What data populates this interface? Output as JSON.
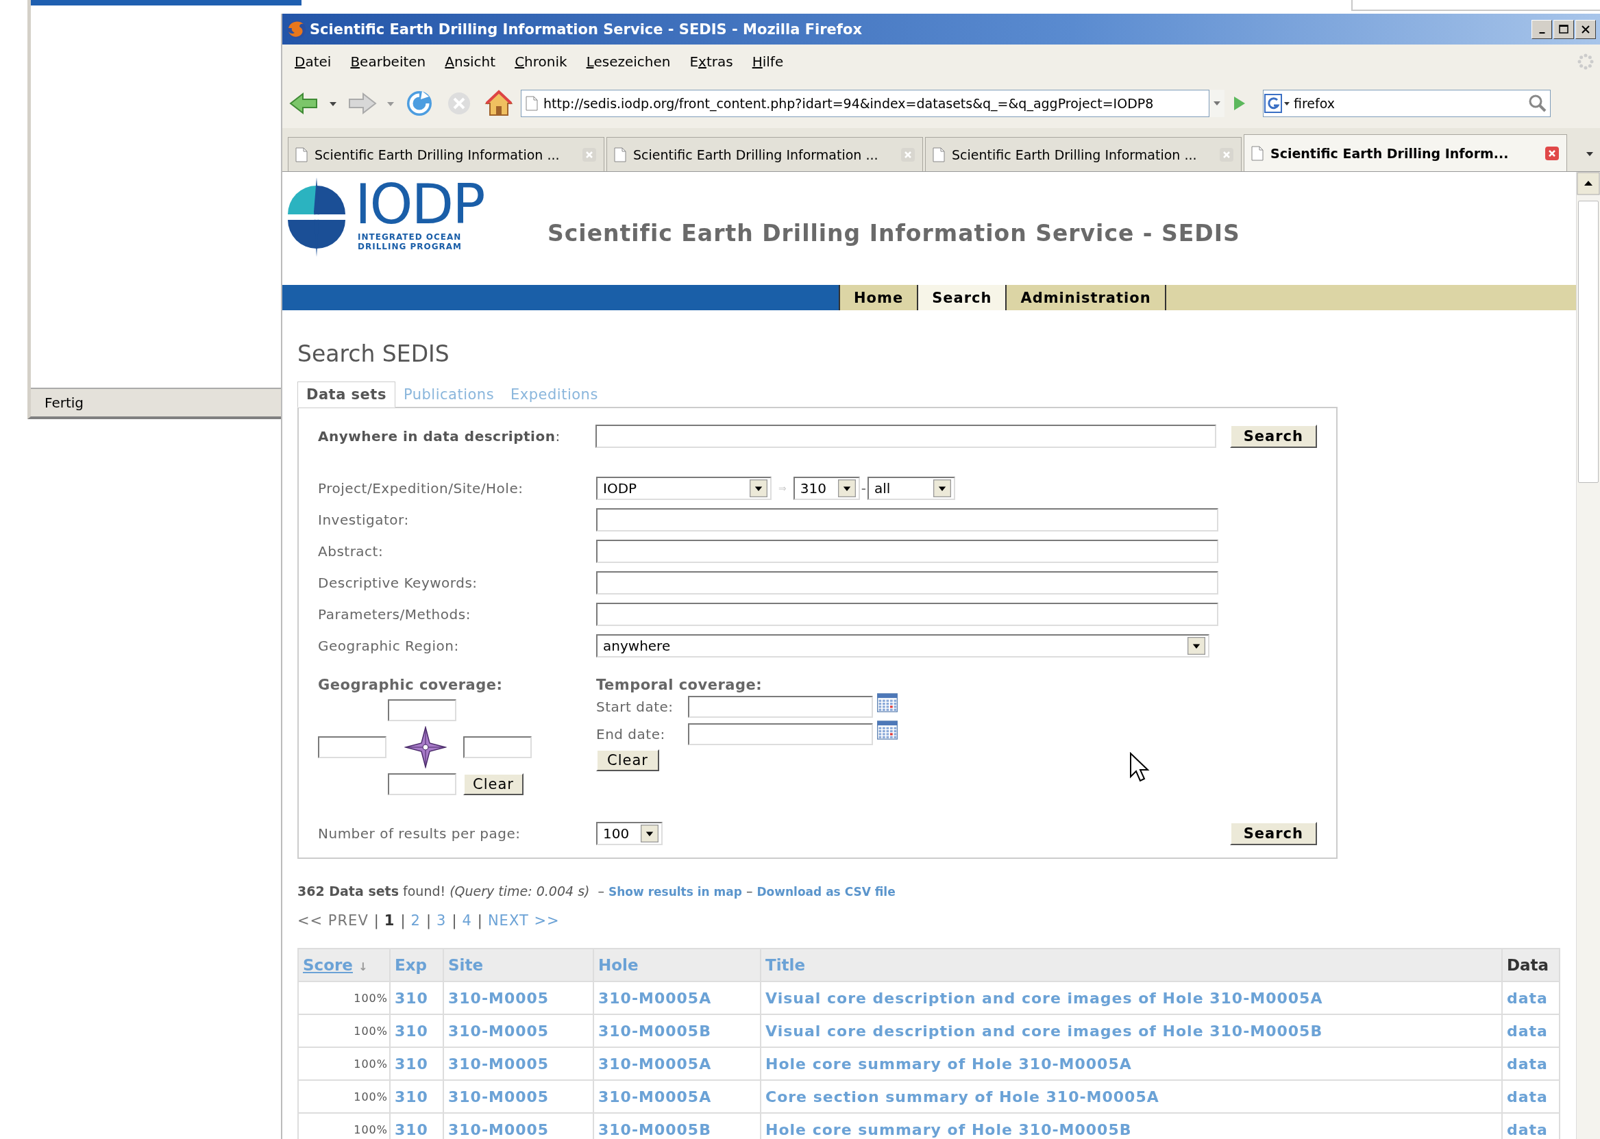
{
  "background_window": {
    "status": "Fertig"
  },
  "window": {
    "title": "Scientific Earth Drilling Information Service - SEDIS - Mozilla Firefox"
  },
  "menu": [
    {
      "accesskey": "D",
      "rest": "atei"
    },
    {
      "accesskey": "B",
      "rest": "earbeiten"
    },
    {
      "accesskey": "A",
      "rest": "nsicht"
    },
    {
      "accesskey": "C",
      "rest": "hronik"
    },
    {
      "accesskey": "L",
      "rest": "esezeichen"
    },
    {
      "before": "E",
      "accesskey": "x",
      "rest": "tras"
    },
    {
      "accesskey": "H",
      "rest": "ilfe"
    }
  ],
  "toolbar": {
    "url": "http://sedis.iodp.org/front_content.php?idart=94&index=datasets&q_=&q_aggProject=IODP8",
    "search_value": "firefox"
  },
  "tabs": [
    {
      "label": "Scientific Earth Drilling Information ...",
      "selected": false
    },
    {
      "label": "Scientific Earth Drilling Information ...",
      "selected": false
    },
    {
      "label": "Scientific Earth Drilling Information ...",
      "selected": false
    },
    {
      "label": "Scientific Earth Drilling Inform...",
      "selected": true
    }
  ],
  "site": {
    "logo": {
      "name": "IODP",
      "subtitle": [
        "INTEGRATED OCEAN",
        "DRILLING PROGRAM"
      ]
    },
    "title": "Scientific Earth Drilling Information Service - SEDIS",
    "nav": [
      {
        "label": "Home",
        "selected": false
      },
      {
        "label": "Search",
        "selected": true
      },
      {
        "label": "Administration",
        "selected": false
      }
    ]
  },
  "heading": "Search SEDIS",
  "search_tabs": [
    {
      "label": "Data sets",
      "selected": true
    },
    {
      "label": "Publications",
      "selected": false
    },
    {
      "label": "Expeditions",
      "selected": false
    }
  ],
  "form": {
    "anywhere": {
      "label": "**Anywhere in data description**:",
      "button": "Search"
    },
    "project": {
      "label": "Project/Expedition/Site/Hole:",
      "project": "IODP",
      "arrow": "⇒",
      "expedition": "310",
      "dash": "-",
      "site": "all"
    },
    "fields": [
      {
        "label": "Investigator:"
      },
      {
        "label": "Abstract:"
      },
      {
        "label": "Descriptive Keywords:"
      },
      {
        "label": "Parameters/Methods:"
      }
    ],
    "region": {
      "label": "Geographic Region:",
      "value": "anywhere"
    },
    "geographic": {
      "label": "Geographic coverage:",
      "clear": "Clear"
    },
    "temporal": {
      "label": "Temporal coverage:",
      "start": "Start date:",
      "end": "End date:",
      "clear": "Clear"
    },
    "per_page": {
      "label": "Number of results per page:",
      "value": "100",
      "button": "Search"
    }
  },
  "results": {
    "summary": "**362 Data sets** found! *(Query time: 0.004 s)*",
    "separator": "–",
    "links": [
      "Show results in map",
      "Download as CSV file"
    ]
  },
  "pagination": {
    "separator": "|",
    "items": [
      {
        "label": "<< PREV",
        "selected": false,
        "disabled": true
      },
      {
        "label": "1",
        "selected": true,
        "disabled": false
      },
      {
        "label": "2",
        "selected": false,
        "disabled": false
      },
      {
        "label": "3",
        "selected": false,
        "disabled": false
      },
      {
        "label": "4",
        "selected": false,
        "disabled": false
      },
      {
        "label": "NEXT >>",
        "selected": false,
        "disabled": false
      }
    ]
  },
  "table": {
    "columns": [
      {
        "label": "Score",
        "kind": "active_sort",
        "sort_mark": "↓"
      },
      {
        "label": "Exp",
        "kind": "sortable"
      },
      {
        "label": "Site",
        "kind": "sortable"
      },
      {
        "label": "Hole",
        "kind": "sortable"
      },
      {
        "label": "Title",
        "kind": "sortable"
      },
      {
        "label": "Data",
        "kind": "plain"
      }
    ],
    "rows": [
      {
        "score": "100%",
        "exp": "310",
        "site": "310-M0005",
        "hole": "310-M0005A",
        "title": "Visual core description and core images of Hole 310-M0005A",
        "data": "data"
      },
      {
        "score": "100%",
        "exp": "310",
        "site": "310-M0005",
        "hole": "310-M0005B",
        "title": "Visual core description and core images of Hole 310-M0005B",
        "data": "data"
      },
      {
        "score": "100%",
        "exp": "310",
        "site": "310-M0005",
        "hole": "310-M0005A",
        "title": "Hole core summary of Hole 310-M0005A",
        "data": "data"
      },
      {
        "score": "100%",
        "exp": "310",
        "site": "310-M0005",
        "hole": "310-M0005A",
        "title": "Core section summary of Hole 310-M0005A",
        "data": "data"
      },
      {
        "score": "100%",
        "exp": "310",
        "site": "310-M0005",
        "hole": "310-M0005B",
        "title": "Hole core summary of Hole 310-M0005B",
        "data": "data"
      }
    ]
  }
}
